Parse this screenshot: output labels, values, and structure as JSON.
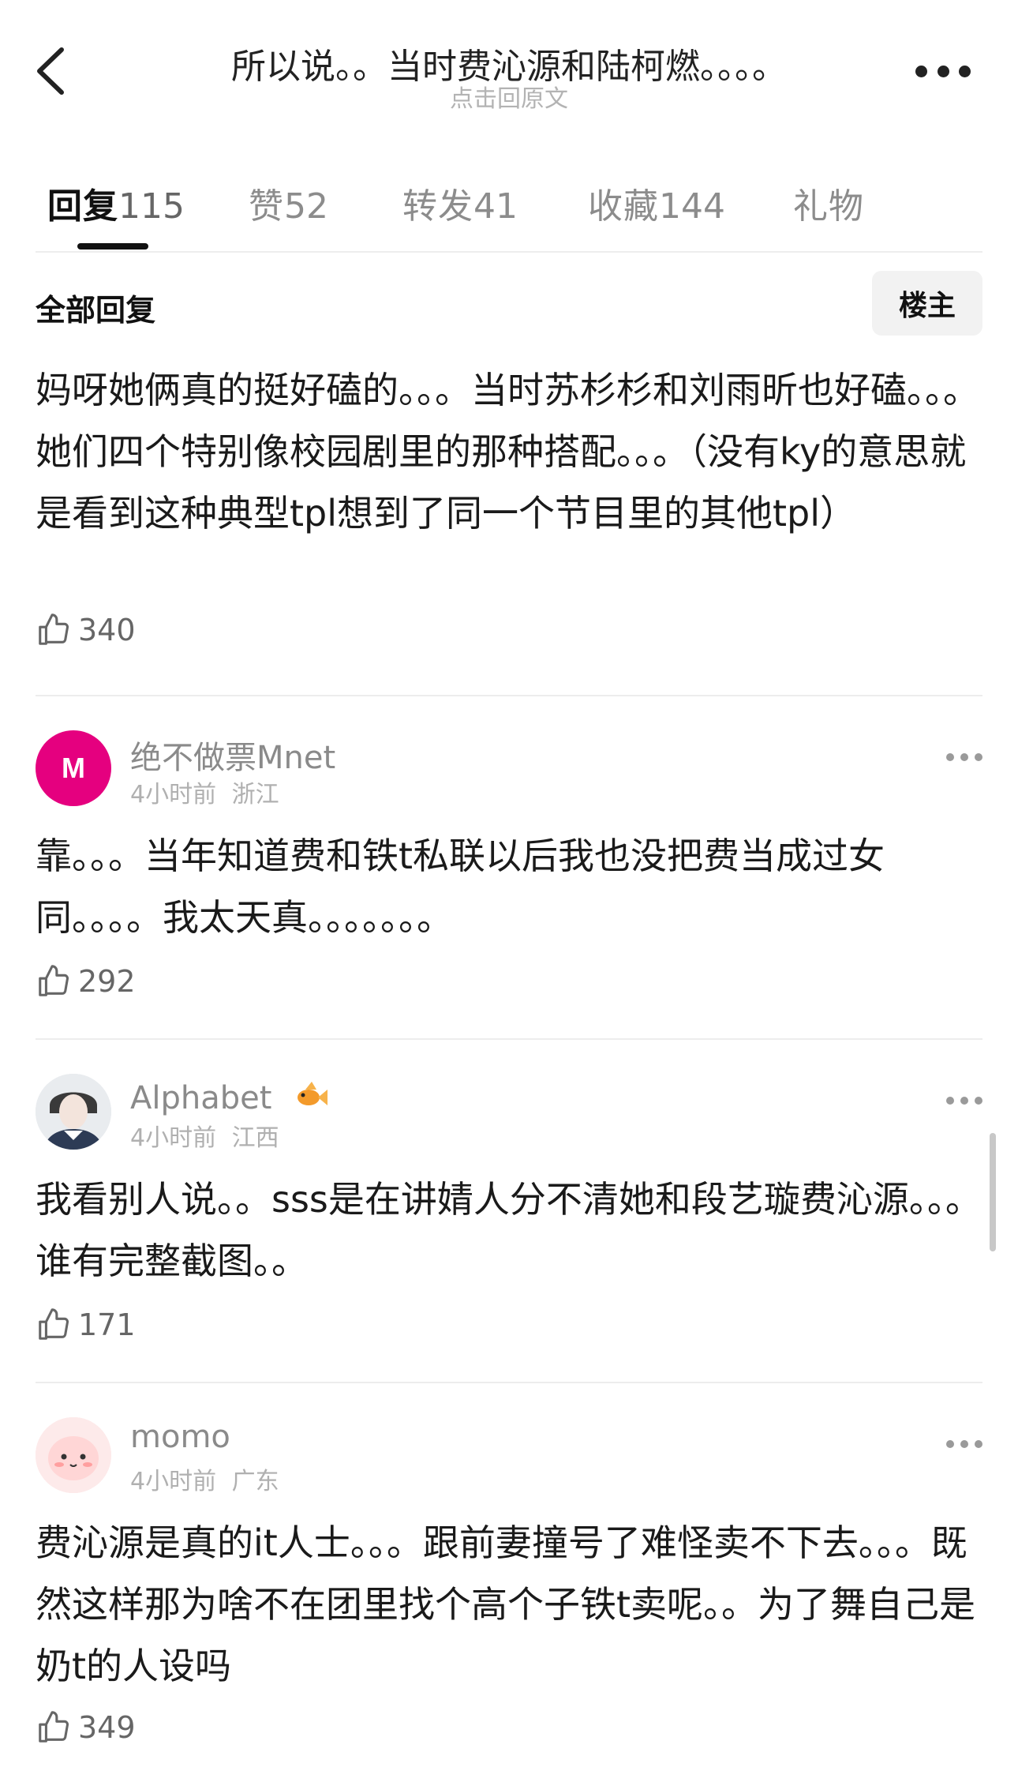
{
  "header": {
    "title": "所以说。。当时费沁源和陆柯燃。。。。",
    "subtitle": "点击回原文"
  },
  "tabs": [
    {
      "label": "回复",
      "count": "115"
    },
    {
      "label": "赞",
      "count": "52"
    },
    {
      "label": "转发",
      "count": "41"
    },
    {
      "label": "收藏",
      "count": "144"
    },
    {
      "label": "礼物",
      "count": ""
    }
  ],
  "section": {
    "title": "全部回复",
    "filter_button": "楼主"
  },
  "comments": [
    {
      "text": "妈呀她俩真的挺好磕的。。。当时苏杉杉和刘雨昕也好磕。。。她们四个特别像校园剧里的那种搭配。。。（没有ky的意思就是看到这种典型tpl想到了同一个节目里的其他tpl）",
      "likes": "340"
    },
    {
      "author": "绝不做票Mnet",
      "time": "4小时前",
      "location": "浙江",
      "avatar_letter": "M",
      "avatar_color": "#e5007f",
      "text": "靠。。。当年知道费和铁t私联以后我也没把费当成过女同。。。。我太天真。。。。。。。",
      "likes": "292"
    },
    {
      "author": "Alphabet",
      "time": "4小时前",
      "location": "江西",
      "text": "我看别人说。。sss是在讲婧人分不清她和段艺璇费沁源。。。谁有完整截图。。",
      "likes": "171"
    },
    {
      "author": "momo",
      "time": "4小时前",
      "location": "广东",
      "text": "费沁源是真的it人士。。。跟前妻撞号了难怪卖不下去。。。既然这样那为啥不在团里找个高个子铁t卖呢。。为了舞自己是奶t的人设吗",
      "likes": "349"
    }
  ]
}
